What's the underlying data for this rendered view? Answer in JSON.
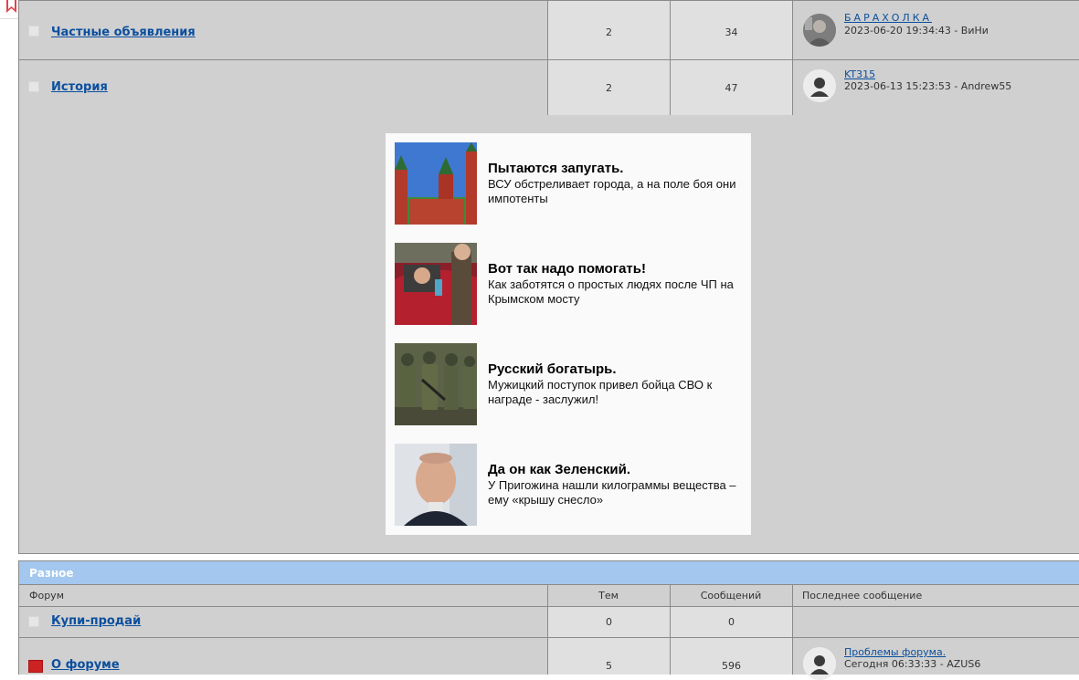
{
  "colors": {
    "link": "#0b4f9e",
    "row_bg": "#d0d0d0",
    "count_bg": "#e0e0e0",
    "category_header_bg": "#a3c7ee",
    "ad_bg": "#fafafa",
    "new_indicator": "#cc2222"
  },
  "forums_top": [
    {
      "name": "Частные объявления",
      "topics": "2",
      "posts": "34",
      "last_title": "БАРАХОЛКА",
      "last_meta": "2023-06-20 19:34:43 - ВиНи",
      "avatar": "photo-avatar"
    },
    {
      "name": "История",
      "topics": "2",
      "posts": "47",
      "last_title": "KT315",
      "last_meta": "2023-06-13 15:23:53 - Andrew55",
      "avatar": "default-user-avatar"
    }
  ],
  "ads": [
    {
      "title": "Пытаются запугать.",
      "desc": "ВСУ обстреливает города, а на поле боя они импотенты",
      "thumb": "kremlin-towers-image"
    },
    {
      "title": "Вот так надо помогать!",
      "desc": "Как заботятся о простых людях после ЧП на Крымском мосту",
      "thumb": "car-window-image"
    },
    {
      "title": "Русский богатырь.",
      "desc": "Мужицкий поступок привел бойца СВО к награде - заслужил!",
      "thumb": "soldiers-image"
    },
    {
      "title": "Да он как Зеленский.",
      "desc": "У Пригожина нашли килограммы вещества – ему «крышу снесло»",
      "thumb": "man-portrait-image"
    }
  ],
  "category": {
    "title": "Разное",
    "columns": {
      "forum": "Форум",
      "topics": "Тем",
      "posts": "Сообщений",
      "last": "Последнее сообщение"
    }
  },
  "forums_bottom": [
    {
      "name": "Купи-продай",
      "topics": "0",
      "posts": "0",
      "last_title": "",
      "last_meta": ""
    },
    {
      "name": "О форуме",
      "topics": "5",
      "posts": "596",
      "last_title": "Проблемы форума.",
      "last_meta": "Сегодня 06:33:33 - AZUS6",
      "avatar": "default-user-avatar"
    }
  ]
}
